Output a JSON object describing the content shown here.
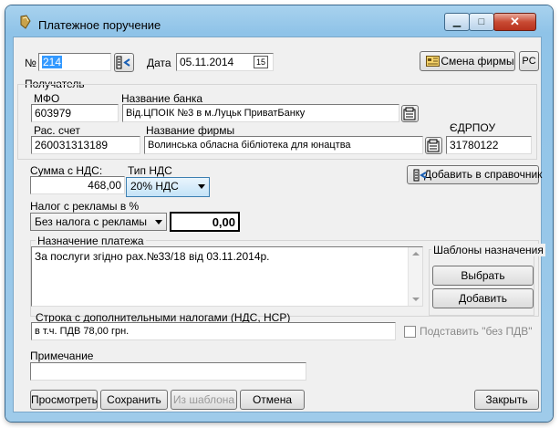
{
  "window": {
    "title": "Платежное поручение",
    "min_glyph": "▁",
    "max_glyph": "□",
    "close_glyph": "✕"
  },
  "header": {
    "number_label": "№",
    "number_value": "214",
    "date_label": "Дата",
    "date_value": "05.11.2014",
    "change_firm_label": "Смена фирмы",
    "pc_label": "PC",
    "calendar_num": "15"
  },
  "recipient": {
    "group_label": "Получатель",
    "mfo_label": "МФО",
    "mfo_value": "603979",
    "bank_label": "Название банка",
    "bank_value": "Вiд.ЦПОIК №3 в м.Луцьк ПриватБанку",
    "account_label": "Рас. счет",
    "account_value": "260031313189",
    "firm_label": "Название фирмы",
    "firm_value": "Волинська обласна бiблiотека для юнацтва",
    "edrpou_label": "ЄДРПОУ",
    "edrpou_value": "31780122"
  },
  "amount": {
    "sum_label": "Сумма с НДС:",
    "sum_value": "468,00",
    "vat_type_label": "Тип НДС",
    "vat_type_value": "20% НДС",
    "add_to_directory_label": "Добавить в справочник"
  },
  "ad_tax": {
    "label": "Налог с рекламы в %",
    "select_value": "Без налога с рекламы",
    "amount_value": "0,00"
  },
  "purpose": {
    "label": "Назначение платежа",
    "text": "За послуги згiдно рах.№33/18 вiд 03.11.2014р.",
    "templates_label": "Шаблоны назначения",
    "choose_label": "Выбрать",
    "add_label": "Добавить"
  },
  "extra_taxes": {
    "label": "Строка с дополнительными налогами (НДС, НСР)",
    "value": "в т.ч. ПДВ 78,00 грн.",
    "no_vat_label": "Подставить \"без ПДВ\""
  },
  "note": {
    "label": "Примечание",
    "value": ""
  },
  "footer": {
    "preview_label": "Просмотреть",
    "save_label": "Сохранить",
    "from_template_label": "Из шаблона",
    "cancel_label": "Отмена",
    "close_label": "Закрыть"
  }
}
